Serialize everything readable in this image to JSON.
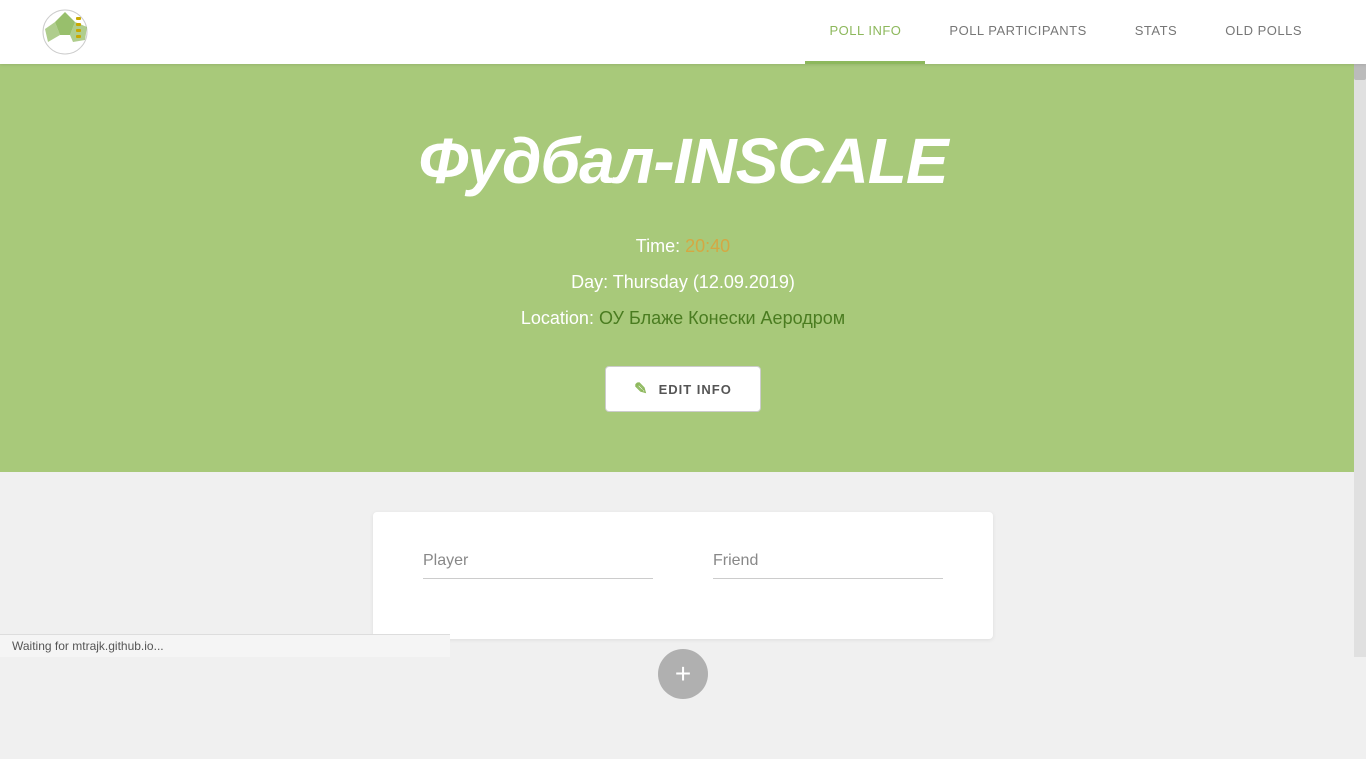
{
  "nav": {
    "links": [
      {
        "label": "POLL INFO",
        "active": true,
        "name": "poll-info"
      },
      {
        "label": "POLL PARTICIPANTS",
        "active": false,
        "name": "poll-participants"
      },
      {
        "label": "STATS",
        "active": false,
        "name": "stats"
      },
      {
        "label": "OLD POLLS",
        "active": false,
        "name": "old-polls"
      }
    ]
  },
  "hero": {
    "title": "Фудбал-INSCALE",
    "time_label": "Time: ",
    "time_value": "20:40",
    "day_label": "Day: ",
    "day_value": "Thursday (12.09.2019)",
    "location_label": "Location: ",
    "location_value": "ОУ Блаже Конески Аеродром",
    "edit_button_label": "EDIT INFO",
    "edit_icon": "✎"
  },
  "player_section": {
    "player_label": "Player",
    "friend_label": "Friend",
    "add_icon": "+"
  },
  "status_bar": {
    "text": "Waiting for mtrajk.github.io..."
  }
}
